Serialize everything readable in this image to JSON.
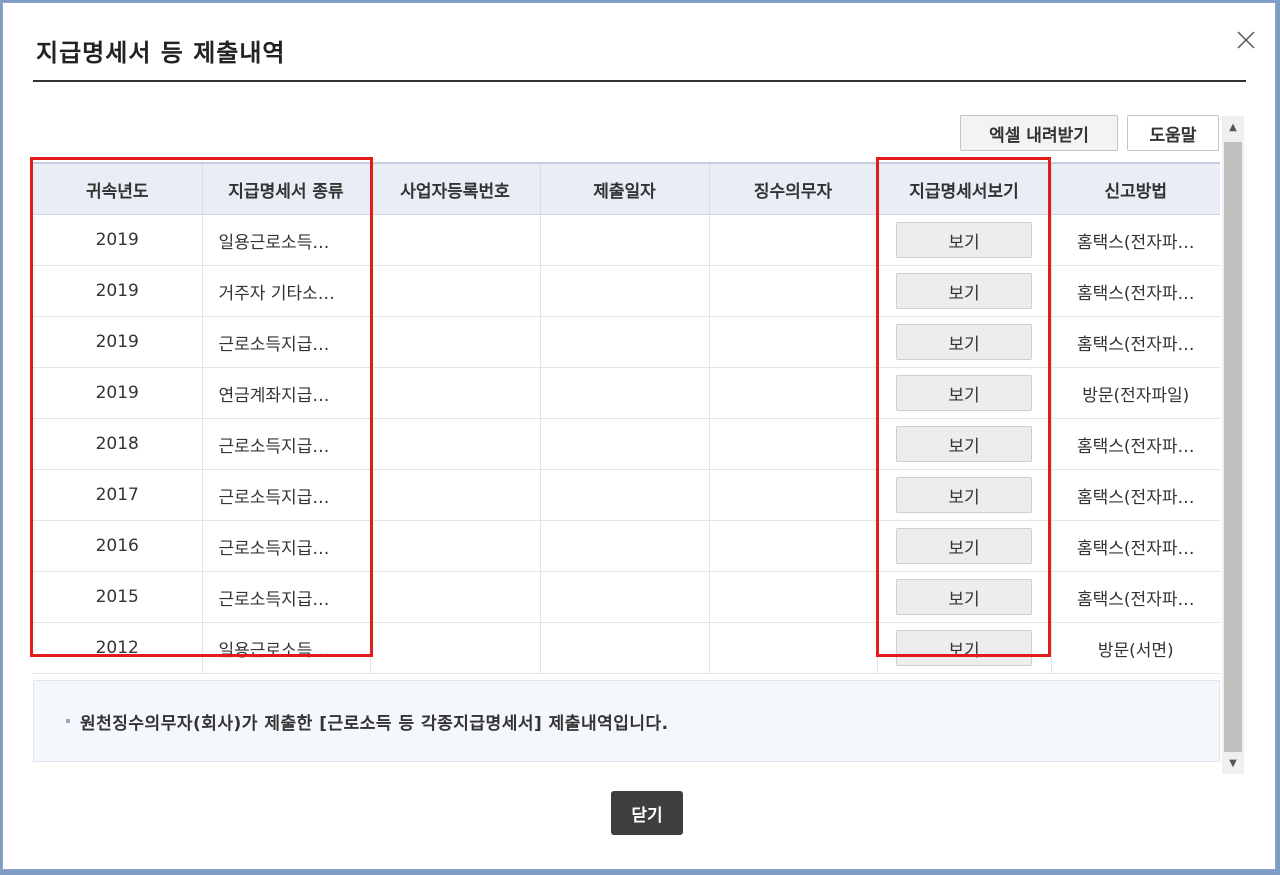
{
  "dialog": {
    "title": "지급명세서 등 제출내역",
    "close_icon": "close-icon"
  },
  "toolbar": {
    "excel_label": "엑셀 내려받기",
    "help_label": "도움말"
  },
  "table": {
    "headers": [
      "귀속년도",
      "지급명세서 종류",
      "사업자등록번호",
      "제출일자",
      "징수의무자",
      "지급명세서보기",
      "신고방법"
    ],
    "view_label": "보기",
    "rows": [
      {
        "year": "2019",
        "type": "일용근로소득…",
        "biz_no": "",
        "date": "",
        "agent": "",
        "method": "홈택스(전자파…"
      },
      {
        "year": "2019",
        "type": "거주자 기타소…",
        "biz_no": "",
        "date": "",
        "agent": "",
        "method": "홈택스(전자파…"
      },
      {
        "year": "2019",
        "type": "근로소득지급…",
        "biz_no": "",
        "date": "",
        "agent": "",
        "method": "홈택스(전자파…"
      },
      {
        "year": "2019",
        "type": "연금계좌지급…",
        "biz_no": "",
        "date": "",
        "agent": "",
        "method": "방문(전자파일)"
      },
      {
        "year": "2018",
        "type": "근로소득지급…",
        "biz_no": "",
        "date": "",
        "agent": "",
        "method": "홈택스(전자파…"
      },
      {
        "year": "2017",
        "type": "근로소득지급…",
        "biz_no": "",
        "date": "",
        "agent": "",
        "method": "홈택스(전자파…"
      },
      {
        "year": "2016",
        "type": "근로소득지급…",
        "biz_no": "",
        "date": "",
        "agent": "",
        "method": "홈택스(전자파…"
      },
      {
        "year": "2015",
        "type": "근로소득지급…",
        "biz_no": "",
        "date": "",
        "agent": "",
        "method": "홈택스(전자파…"
      },
      {
        "year": "2012",
        "type": "일용근로소득…",
        "biz_no": "",
        "date": "",
        "agent": "",
        "method": "방문(서면)"
      }
    ]
  },
  "notice": {
    "text": "원천징수의무자(회사)가 제출한 [근로소득 등 각종지급명세서] 제출내역입니다."
  },
  "footer": {
    "close_label": "닫기"
  },
  "colors": {
    "highlight": "#e21b1b",
    "header_bg": "#e9eef6",
    "close_button_bg": "#3e3e3e"
  }
}
